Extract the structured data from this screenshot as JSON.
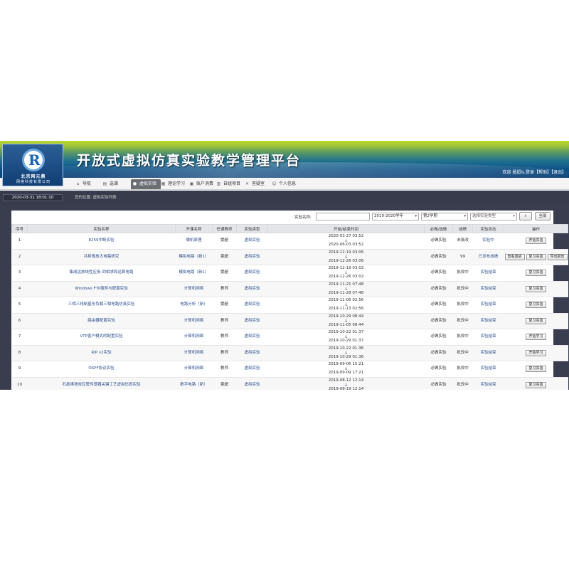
{
  "header": {
    "logo_line1": "北京网元鼎",
    "logo_line2": "网络科技有限公司",
    "logo_letter": "R",
    "title": "开放式虚拟仿真实验教学管理平台",
    "welcome": "欢迎 曼超ls,登录【帮助】【退出】"
  },
  "nav": [
    {
      "label": "导航",
      "icon": "home-icon"
    },
    {
      "label": "选课",
      "icon": "book-icon"
    },
    {
      "label": "虚拟实验",
      "icon": "flask-icon"
    },
    {
      "label": "理论学习",
      "icon": "grid-icon"
    },
    {
      "label": "账户消费",
      "icon": "wallet-icon"
    },
    {
      "label": "自组项目",
      "icon": "folder-icon"
    },
    {
      "label": "答疑室",
      "icon": "tools-icon"
    },
    {
      "label": "个人信息",
      "icon": "user-icon"
    }
  ],
  "infobar": {
    "datetime": "2020-03-31   18:01:10",
    "location": "您的位置: 虚拟实验列表"
  },
  "search": {
    "label": "实验名称:",
    "year": "2019-2020学年",
    "term": "第2学期",
    "type_placeholder": "选择实验类型",
    "search_icon": "magnifier-icon",
    "all_label": "全部"
  },
  "table": {
    "headers": [
      "序号",
      "实验名称",
      "开课名称",
      "任课教师",
      "实验类型",
      "开始/结束时间",
      "必做/选做",
      "成绩",
      "实验状态",
      "操作"
    ],
    "rows": [
      {
        "no": "1",
        "name": "8259中断实验",
        "course": "微机原理",
        "teacher": "雯超",
        "kind": "虚拟实验",
        "start": "2020-03-27 03:52",
        "end": "2020-06-03 03:52",
        "req": "必做实验",
        "score": "未批改",
        "status": "实验中",
        "ops": [
          "开始实验"
        ]
      },
      {
        "no": "2",
        "name": "共射极放大电路研究",
        "course": "模拟电路（新1）",
        "teacher": "雯超",
        "kind": "虚拟实验",
        "start": "2019-12-19 03:06",
        "end": "2019-12-26 03:06",
        "req": "必做实验",
        "score": "99",
        "status": "已发布成绩",
        "ops": [
          "查看成绩",
          "复习实验",
          "导出报告"
        ]
      },
      {
        "no": "3",
        "name": "集成运放线性应用-同相求和运算电路",
        "course": "模拟电路（新1）",
        "teacher": "雯超",
        "kind": "虚拟实验",
        "start": "2019-12-19 03:02",
        "end": "2019-12-26 03:02",
        "req": "必做实验",
        "score": "批改中",
        "status": "实验结束",
        "ops": [
          "复习实验"
        ]
      },
      {
        "no": "4",
        "name": "Windows FTP服务与配置实验",
        "course": "计算机网络",
        "teacher": "教师",
        "kind": "虚拟实验",
        "start": "2019-11-21 07:48",
        "end": "2019-11-28 07:48",
        "req": "必做实验",
        "score": "批改中",
        "status": "实验结束",
        "ops": [
          "复习实验"
        ]
      },
      {
        "no": "5",
        "name": "三相三线制星形负载三相电路仿真实验",
        "course": "电路分析（新）",
        "teacher": "雯超",
        "kind": "虚拟实验",
        "start": "2019-11-06 02:56",
        "end": "2019-11-13 02:56",
        "req": "必做实验",
        "score": "批改中",
        "status": "实验结束",
        "ops": [
          "复习实验"
        ]
      },
      {
        "no": "6",
        "name": "路由器配置实验",
        "course": "计算机网络",
        "teacher": "教师",
        "kind": "虚拟实验",
        "start": "2019-10-29 08:44",
        "end": "2019-11-05 08:44",
        "req": "必做实验",
        "score": "批改中",
        "status": "实验结束",
        "ops": [
          "复习实验"
        ]
      },
      {
        "no": "7",
        "name": "VTP客户模式的配置实验",
        "course": "计算机网络",
        "teacher": "教师",
        "kind": "虚拟实验",
        "start": "2019-10-22 01:37",
        "end": "2019-10-29 01:37",
        "req": "必做实验",
        "score": "批改中",
        "status": "实验结束",
        "ops": [
          "开始学习"
        ]
      },
      {
        "no": "8",
        "name": "RIP v2实验",
        "course": "计算机网络",
        "teacher": "教师",
        "kind": "虚拟实验",
        "start": "2019-10-22 01:36",
        "end": "2019-10-29 01:36",
        "req": "必做实验",
        "score": "批改中",
        "status": "实验结束",
        "ops": [
          "开始学习"
        ]
      },
      {
        "no": "9",
        "name": "OSPF协议实验",
        "course": "计算机网络",
        "teacher": "教师",
        "kind": "虚拟实验",
        "start": "2019-09-06 15:21",
        "end": "2019-09-09 17:21",
        "req": "必做实验",
        "score": "批改中",
        "status": "实验结束",
        "ops": [
          "复习实验"
        ]
      },
      {
        "no": "10",
        "name": "石墨烯场效应管传感器关键工艺虚拟仿真实验",
        "course": "数字电路（新）",
        "teacher": "雯超",
        "kind": "虚拟实验",
        "start": "2019-08-12 12:14",
        "end": "2019-08-19 12:14",
        "req": "必做实验",
        "score": "批改中",
        "status": "实验结束",
        "ops": [
          "复习实验"
        ]
      }
    ]
  },
  "colors": {
    "banner_top": "#bdd62a",
    "banner_bottom": "#0a3f74",
    "frame": "#3a3d4e",
    "link": "#2a4e8a"
  }
}
